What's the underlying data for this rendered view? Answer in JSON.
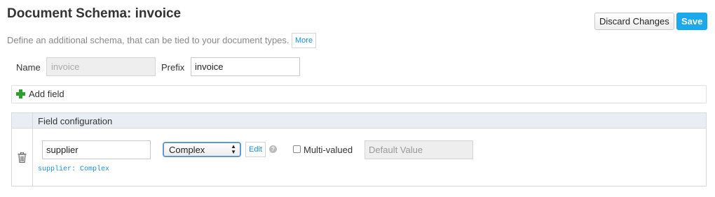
{
  "header": {
    "title": "Document Schema: invoice",
    "discard_label": "Discard Changes",
    "save_label": "Save",
    "description": "Define an additional schema, that can be tied to your document types.",
    "more_label": "More"
  },
  "schema": {
    "name_label": "Name",
    "name_value": "invoice",
    "prefix_label": "Prefix",
    "prefix_value": "invoice"
  },
  "add_field": {
    "label": "Add field",
    "icon": "plus-icon"
  },
  "field_config": {
    "header": "Field configuration",
    "fields": [
      {
        "name": "supplier",
        "type": "Complex",
        "edit_label": "Edit",
        "help_glyph": "?",
        "multivalued_label": "Multi-valued",
        "multivalued": false,
        "default_placeholder": "Default Value",
        "caption": "supplier: Complex"
      }
    ]
  },
  "colors": {
    "accent": "#1aa9ec",
    "link": "#1a8fd6",
    "add_icon": "#2e9e2e",
    "header_bg": "#e9eef5"
  }
}
